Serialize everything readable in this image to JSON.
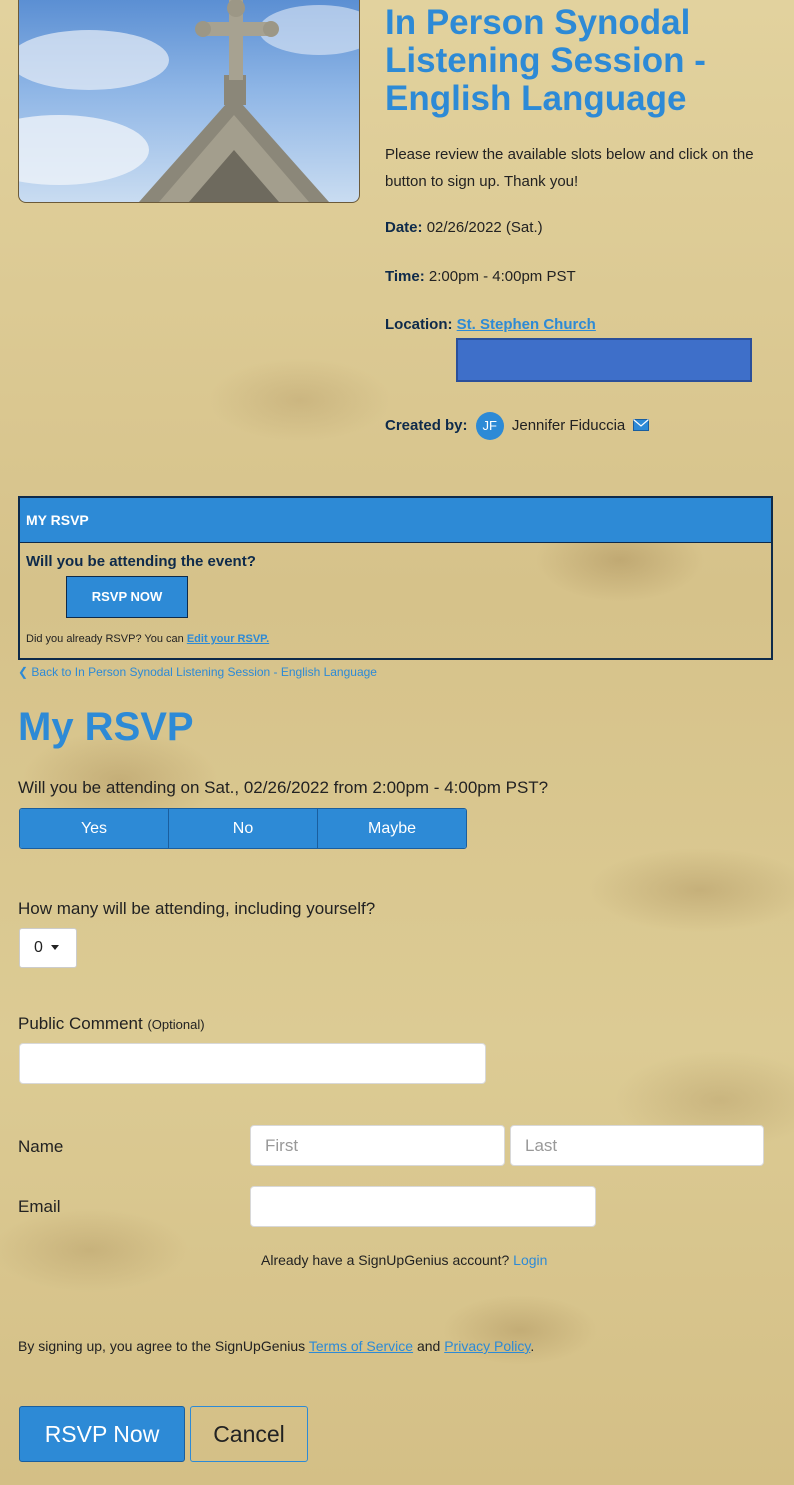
{
  "event": {
    "title": "In Person Synodal Listening Session - English Language",
    "intro": "Please review the available slots below and click on the button to sign up. Thank you!",
    "date_label": "Date:",
    "date_value": "02/26/2022 (Sat.)",
    "time_label": "Time:",
    "time_value": "2:00pm - 4:00pm PST",
    "location_label": "Location:",
    "location_value": "St. Stephen Church",
    "created_label": "Created by:",
    "creator_initials": "JF",
    "creator_name": "Jennifer Fiduccia"
  },
  "panel": {
    "header": "MY RSVP",
    "question": "Will you be attending the event?",
    "button": "RSVP NOW",
    "note_prefix": "Did you already RSVP? You can ",
    "note_link": "Edit your RSVP."
  },
  "back_link": "Back to In Person Synodal Listening Session - English Language",
  "page_title": "My RSVP",
  "attend_question": "Will you be attending on Sat., 02/26/2022 from 2:00pm - 4:00pm PST?",
  "attend_options": [
    "Yes",
    "No",
    "Maybe"
  ],
  "count_question": "How many will be attending, including yourself?",
  "count_value": "0",
  "comment": {
    "label": "Public Comment",
    "optional": "(Optional)",
    "value": ""
  },
  "name": {
    "label": "Name",
    "first_placeholder": "First",
    "last_placeholder": "Last"
  },
  "email": {
    "label": "Email",
    "value": ""
  },
  "login": {
    "prefix": "Already have a SignUpGenius account? ",
    "link": "Login"
  },
  "terms": {
    "prefix": "By signing up, you agree to the SignUpGenius ",
    "tos": "Terms of Service",
    "and": " and ",
    "privacy": "Privacy Policy",
    "suffix": "."
  },
  "actions": {
    "submit": "RSVP Now",
    "cancel": "Cancel"
  },
  "colors": {
    "accent": "#2d8ad6",
    "dark": "#0e2a4a",
    "background": "#d8c48e"
  }
}
